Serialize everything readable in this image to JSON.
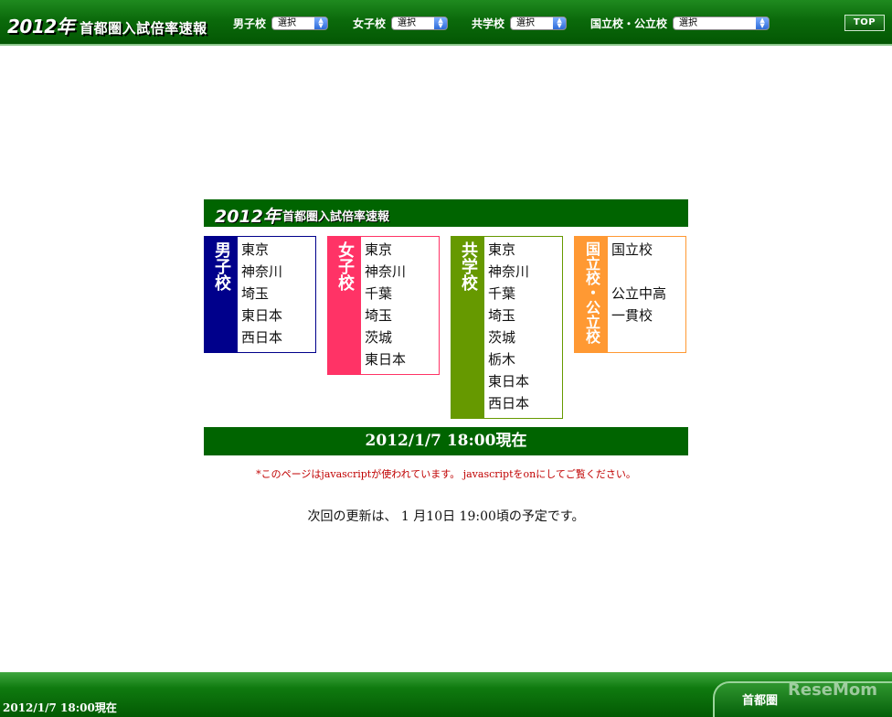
{
  "header": {
    "year": "2012年",
    "title": "首都圏入試倍率速報",
    "selects": [
      {
        "label": "男子校",
        "value": "選択"
      },
      {
        "label": "女子校",
        "value": "選択"
      },
      {
        "label": "共学校",
        "value": "選択"
      },
      {
        "label": "国立校・公立校",
        "value": "選択"
      }
    ],
    "top_button": "TOP"
  },
  "panel": {
    "year": "2012年",
    "title": "首都圏入試倍率速報",
    "categories": [
      {
        "name": "男子校",
        "color": "#00008b",
        "items": [
          "東京",
          "神奈川",
          "埼玉",
          "東日本",
          "西日本"
        ]
      },
      {
        "name": "女子校",
        "color": "#ff3366",
        "items": [
          "東京",
          "神奈川",
          "千葉",
          "埼玉",
          "茨城",
          "東日本"
        ]
      },
      {
        "name": "共学校",
        "color": "#669900",
        "items": [
          "東京",
          "神奈川",
          "千葉",
          "埼玉",
          "茨城",
          "栃木",
          "東日本",
          "西日本"
        ]
      },
      {
        "name": "国立校・公立校",
        "color": "#ff9933",
        "items": [
          "国立校",
          "",
          "公立中高",
          "一貫校"
        ]
      }
    ],
    "status": "2012/1/7 18:00現在",
    "js_note": "*このページはjavascriptが使われています。 javascriptをonにしてご覧ください。",
    "next_update": "次回の更新は、 1 月10日 19:00頃の予定です。"
  },
  "footer": {
    "date": "2012/1/7 18:00現在",
    "tab_title": "首都圏",
    "watermark": "ReseMom"
  }
}
